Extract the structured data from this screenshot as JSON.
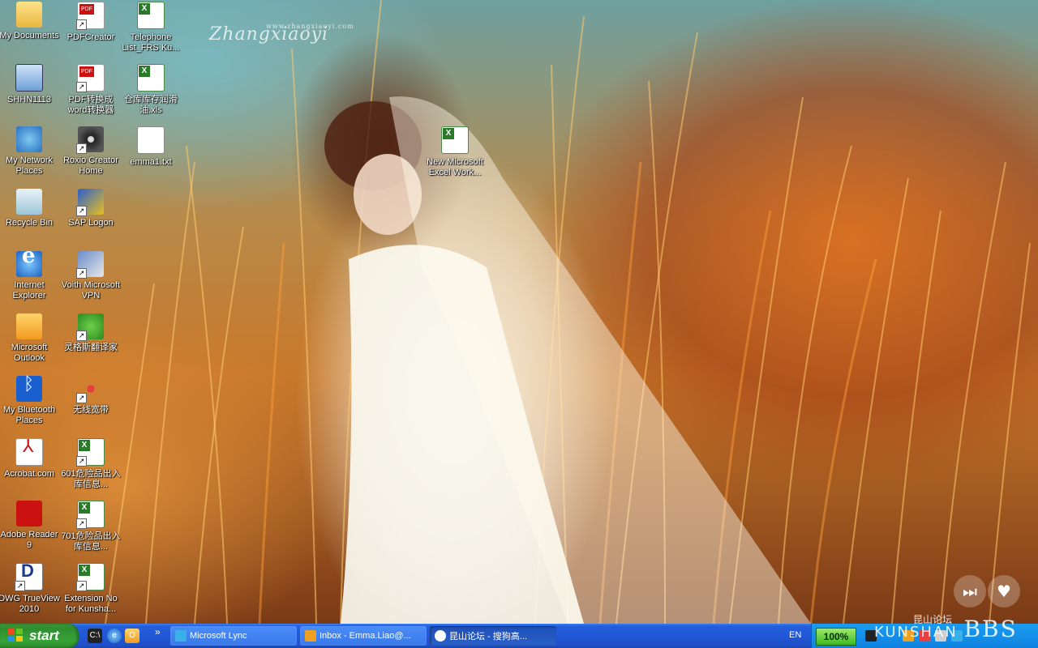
{
  "desktop": {
    "watermark": "Zhangxiaoyi",
    "watermark_url": "www.zhangxiaoyi.com",
    "icons": [
      {
        "label": "My Documents",
        "icon": "folder-icon"
      },
      {
        "label": "PDFCreator",
        "icon": "pdf-icon"
      },
      {
        "label": "Telephone List_FRS Ku...",
        "icon": "excel-icon"
      },
      {
        "label": "SHHN1113",
        "icon": "computer-icon"
      },
      {
        "label": "PDF转换成word转换器",
        "icon": "pdf-converter-icon"
      },
      {
        "label": "仓库库存润滑油.xls",
        "icon": "excel-icon"
      },
      {
        "label": "My Network Places",
        "icon": "network-icon"
      },
      {
        "label": "Roxio Creator Home",
        "icon": "roxio-icon"
      },
      {
        "label": "emma1.txt",
        "icon": "text-file-icon"
      },
      {
        "label": "New Microsoft Excel Work...",
        "icon": "excel-icon"
      },
      {
        "label": "Recycle Bin",
        "icon": "recycle-bin-icon"
      },
      {
        "label": "SAP Logon",
        "icon": "sap-icon"
      },
      {
        "label": "Internet Explorer",
        "icon": "ie-icon"
      },
      {
        "label": "Voith Microsoft VPN",
        "icon": "vpn-icon"
      },
      {
        "label": "Microsoft Outlook",
        "icon": "outlook-icon"
      },
      {
        "label": "灵格斯翻译家",
        "icon": "lingoes-icon"
      },
      {
        "label": "My Bluetooth Places",
        "icon": "bluetooth-icon"
      },
      {
        "label": "无线宽带",
        "icon": "wireless-icon"
      },
      {
        "label": "Acrobat.com",
        "icon": "acrobat-icon"
      },
      {
        "label": "601危险品出入库信息...",
        "icon": "excel-icon"
      },
      {
        "label": "Adobe Reader 9",
        "icon": "adobe-reader-icon"
      },
      {
        "label": "701危险品出入库信息...",
        "icon": "excel-icon"
      },
      {
        "label": "DWG TrueView 2010",
        "icon": "dwg-icon"
      },
      {
        "label": "Extension No for Kunsha...",
        "icon": "excel-icon"
      }
    ]
  },
  "taskbar": {
    "start_label": "start",
    "quick_launch": [
      "cmd-icon",
      "ie-icon",
      "outlook-icon"
    ],
    "overflow": "»",
    "tasks": [
      {
        "label": "Microsoft Lync",
        "icon": "lync-icon"
      },
      {
        "label": "Inbox - Emma.Liao@...",
        "icon": "outlook-icon"
      },
      {
        "label": "昆山论坛 - 搜狗高...",
        "icon": "sogou-browser-icon",
        "active": true
      }
    ],
    "language": "EN",
    "zoom": "100%",
    "brand": "KUNSHAN",
    "brand_cn": "昆山论坛",
    "brand_bbs": "BBS"
  }
}
